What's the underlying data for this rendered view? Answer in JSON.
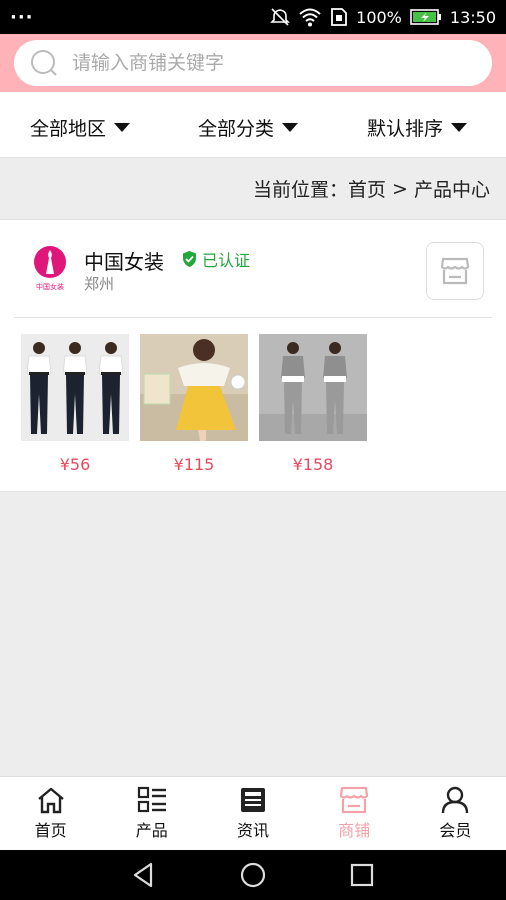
{
  "status_bar": {
    "menu_dots": "···",
    "battery": "100%",
    "time": "13:50"
  },
  "search": {
    "placeholder": "请输入商铺关键字"
  },
  "filters": [
    {
      "label": "全部地区"
    },
    {
      "label": "全部分类"
    },
    {
      "label": "默认排序"
    }
  ],
  "breadcrumb": {
    "prefix": "当前位置：",
    "home": "首页",
    "sep": " > ",
    "current": "产品中心"
  },
  "shop": {
    "logo_text": "中国女装",
    "name": "中国女装",
    "verified_label": "已认证",
    "city": "郑州",
    "products": [
      {
        "price": "¥56"
      },
      {
        "price": "¥115"
      },
      {
        "price": "¥158"
      }
    ]
  },
  "tabbar": {
    "items": [
      {
        "label": "首页",
        "icon": "home-icon"
      },
      {
        "label": "产品",
        "icon": "product-list-icon"
      },
      {
        "label": "资讯",
        "icon": "news-icon"
      },
      {
        "label": "商铺",
        "icon": "store-icon",
        "active": true
      },
      {
        "label": "会员",
        "icon": "user-icon"
      }
    ]
  },
  "colors": {
    "header_pink": "#ffb3b8",
    "price_red": "#e84a5f",
    "verified_green": "#22a83a",
    "tab_active": "#f3a2aa"
  }
}
